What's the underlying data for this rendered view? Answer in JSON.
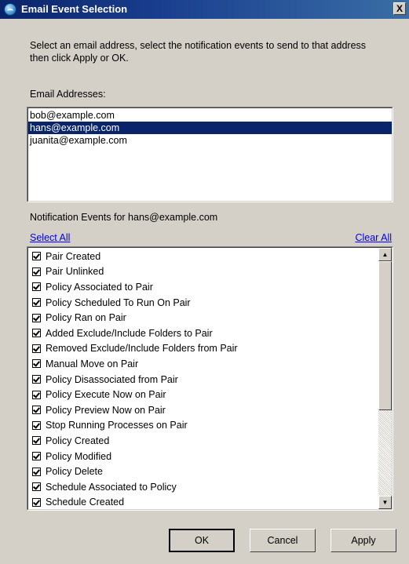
{
  "window": {
    "title": "Email Event Selection",
    "close_label": "X"
  },
  "instructions": "Select an email address, select the notification events to send to that address then click Apply or OK.",
  "email_section": {
    "label": "Email Addresses:",
    "addresses": [
      "bob@example.com",
      "hans@example.com",
      "juanita@example.com"
    ],
    "selected": "hans@example.com"
  },
  "events_section": {
    "label": "Notification Events for hans@example.com",
    "select_all": "Select All",
    "clear_all": "Clear All",
    "events": [
      {
        "label": "Pair Created",
        "checked": true
      },
      {
        "label": "Pair Unlinked",
        "checked": true
      },
      {
        "label": "Policy Associated to Pair",
        "checked": true
      },
      {
        "label": "Policy Scheduled To Run On Pair",
        "checked": true
      },
      {
        "label": "Policy Ran on Pair",
        "checked": true
      },
      {
        "label": "Added Exclude/Include Folders to Pair",
        "checked": true
      },
      {
        "label": "Removed Exclude/Include Folders from Pair",
        "checked": true
      },
      {
        "label": "Manual Move on Pair",
        "checked": true
      },
      {
        "label": "Policy Disassociated from Pair",
        "checked": true
      },
      {
        "label": "Policy Execute Now on Pair",
        "checked": true
      },
      {
        "label": "Policy Preview Now on Pair",
        "checked": true
      },
      {
        "label": "Stop Running Processes on Pair",
        "checked": true
      },
      {
        "label": "Policy Created",
        "checked": true
      },
      {
        "label": "Policy Modified",
        "checked": true
      },
      {
        "label": "Policy Delete",
        "checked": true
      },
      {
        "label": "Schedule Associated to Policy",
        "checked": true
      },
      {
        "label": "Schedule Created",
        "checked": true
      }
    ]
  },
  "buttons": {
    "ok": "OK",
    "cancel": "Cancel",
    "apply": "Apply"
  },
  "icons": {
    "app": "globe-arrow-icon",
    "close": "close-icon",
    "scroll_up": "scroll-up-arrow-icon",
    "scroll_down": "scroll-down-arrow-icon"
  },
  "colors": {
    "selection": "#0a246a",
    "link": "#0000ee",
    "window_bg": "#d4d0c8"
  }
}
